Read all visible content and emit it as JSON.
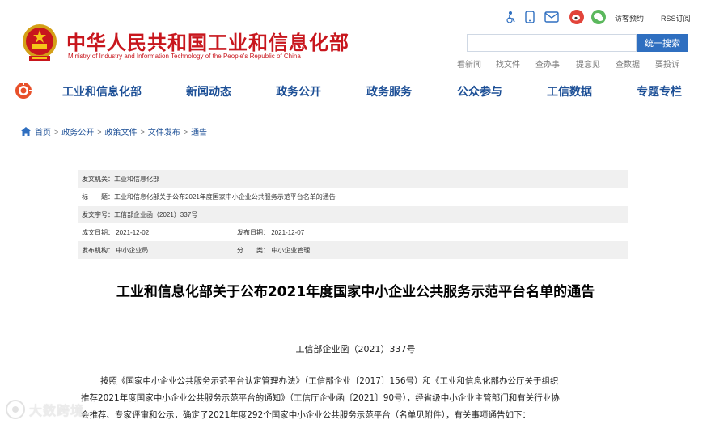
{
  "header": {
    "site_title": "中华人民共和国工业和信息化部",
    "site_subtitle": "Ministry of Industry and Information Technology of the People's Republic of China",
    "top_links": {
      "accessible": "访客预约",
      "rss": "RSS订阅"
    },
    "top_icons": [
      "accessibility-icon",
      "mobile-icon",
      "mail-icon",
      "weibo-icon",
      "wechat-icon"
    ],
    "search": {
      "placeholder": "",
      "button": "统一搜索"
    },
    "quick_links": [
      "看新闻",
      "找文件",
      "查办事",
      "提意见",
      "查数据",
      "要投诉"
    ]
  },
  "nav": {
    "items": [
      "工业和信息化部",
      "新闻动态",
      "政务公开",
      "政务服务",
      "公众参与",
      "工信数据",
      "专题专栏"
    ]
  },
  "breadcrumb": [
    "首页",
    "政务公开",
    "政策文件",
    "文件发布",
    "通告"
  ],
  "meta": {
    "issuer_key": "发文机关：",
    "issuer_val": "工业和信息化部",
    "title_key": "标　　题：",
    "title_val": "工业和信息化部关于公布2021年度国家中小企业公共服务示范平台名单的通告",
    "docno_key": "发文字号：",
    "docno_val": "工信部企业函（2021）337号",
    "written_key": "成文日期：",
    "written_val": "2021-12-02",
    "published_key": "发布日期：",
    "published_val": "2021-12-07",
    "org_key": "发布机构：",
    "org_val": "中小企业局",
    "category_key": "分　　类：",
    "category_val": "中小企业管理"
  },
  "document": {
    "title": "工业和信息化部关于公布2021年度国家中小企业公共服务示范平台名单的通告",
    "doc_number": "工信部企业函（2021）337号",
    "lines": [
      "按照《国家中小企业公共服务示范平台认定管理办法》（工信部企业〔2017〕156号）和《工业和信息化部办公厅关于组织",
      "推荐2021年度国家中小企业公共服务示范平台的通知》（工信厅企业函〔2021〕90号），经省级中小企业主管部门和有关行业协",
      "会推荐、专家评审和公示，确定了2021年度292个国家中小企业公共服务示范平台（名单见附件），有关事项通告如下："
    ]
  },
  "watermark": "大数跨境",
  "colors": {
    "brand_red": "#c8161d",
    "nav_blue": "#1c4f96",
    "search_blue": "#2f6fc0"
  }
}
